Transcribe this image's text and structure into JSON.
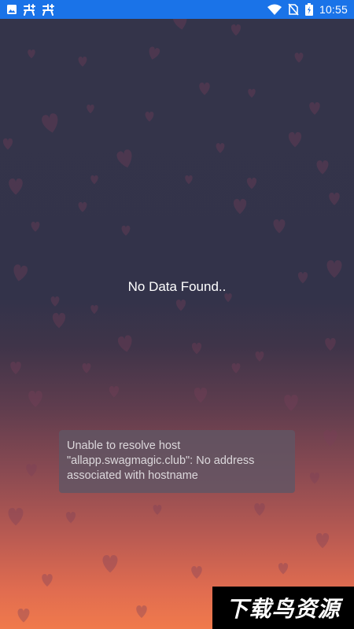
{
  "status_bar": {
    "time": "10:55",
    "left_icons": [
      "image-icon",
      "bug-icon",
      "bug-icon"
    ],
    "right_icons": [
      "wifi-icon",
      "no-sim-icon",
      "battery-charging-icon"
    ],
    "background_color": "#1a73e8"
  },
  "main": {
    "empty_message": "No Data Found.."
  },
  "toast": {
    "lines": [
      "Unable to resolve host",
      "\"allapp.swagmagic.club\": No address",
      "associated with hostname"
    ]
  },
  "watermark": {
    "text": "下载鸟资源"
  },
  "colors": {
    "background_top": "#34344a",
    "background_bottom": "#f07a4c",
    "heart_color": "#7a3f5a"
  }
}
